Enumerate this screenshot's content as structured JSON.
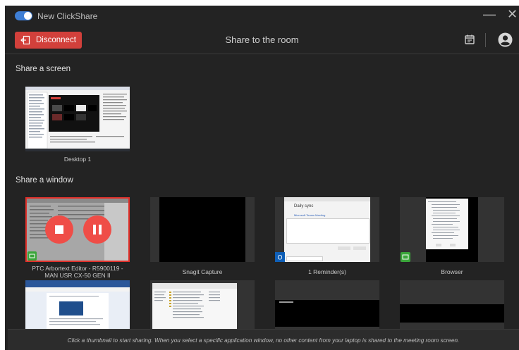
{
  "app": {
    "toggle_label": "New ClickShare",
    "toggle_on": true,
    "title": "Share to the room",
    "disconnect_label": "Disconnect",
    "minimize_glyph": "—",
    "close_glyph": "✕"
  },
  "icons": {
    "toggle": "toggle-switch-icon",
    "disconnect": "exit-door-icon",
    "calendar": "calendar-icon",
    "account": "account-circle-icon",
    "stop": "stop-icon",
    "pause": "pause-icon",
    "window_badge": "window-share-icon",
    "outlook": "outlook-icon"
  },
  "colors": {
    "accent": "#3f7fd6",
    "danger": "#d2403b",
    "selected_border": "#e0302a",
    "badge_green": "#3aa53a",
    "background": "#232323"
  },
  "sections": {
    "screen_title": "Share a screen",
    "window_title": "Share a window"
  },
  "screens": [
    {
      "caption": "Desktop 1"
    }
  ],
  "windows": [
    {
      "caption": "PTC Arbortext Editor - R5900119 - MAN USR CX-50 GEN II",
      "selected": true
    },
    {
      "caption": "Snagit Capture",
      "selected": false
    },
    {
      "caption": "1 Reminder(s)",
      "selected": false
    },
    {
      "caption": "Browser",
      "selected": false
    },
    {
      "caption": "",
      "selected": false
    },
    {
      "caption": "",
      "selected": false
    },
    {
      "caption": "",
      "selected": false
    },
    {
      "caption": "",
      "selected": false
    }
  ],
  "reminder_preview": {
    "title": "Daily sync",
    "subtitle": "Microsoft Teams Meeting"
  },
  "footer": {
    "text": "Click a thumbnail to start sharing. When you select a specific application window, no other content from your laptop is shared to the meeting room screen."
  }
}
